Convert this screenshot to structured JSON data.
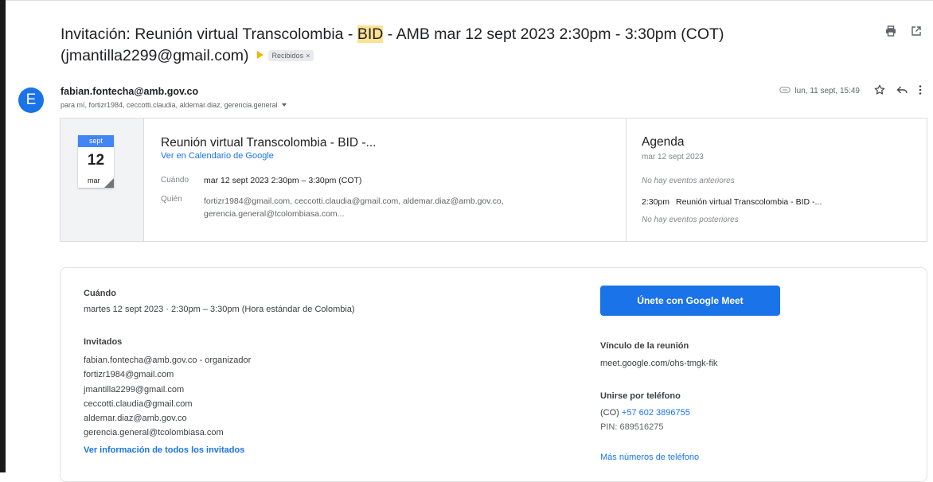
{
  "subject": {
    "before": "Invitación: Reunión virtual Transcolombia - ",
    "highlight": "BID",
    "after": " - AMB mar 12 sept 2023 2:30pm - 3:30pm (COT)",
    "line2": "(jmantilla2299@gmail.com)",
    "label": "Recibidos",
    "label_close": "×"
  },
  "top_icons": [
    "print-icon",
    "open-in-new-window-icon"
  ],
  "sender": {
    "avatar_letter": "E",
    "email": "fabian.fontecha@amb.gov.co",
    "recipients": "para mí, fortizr1984, ceccotti.claudia, aldemar.diaz, gerencia.general",
    "date": "lun, 11 sept, 15:49"
  },
  "invite": {
    "cal_month_head": "sept",
    "cal_day": "12",
    "cal_weekday": "mar",
    "title": "Reunión virtual Transcolombia - BID -...",
    "calendar_link": "Ver en Calendario de Google",
    "when_label": "Cuándo",
    "when_value": "mar 12 sept 2023 2:30pm – 3:30pm (COT)",
    "who_label": "Quién",
    "who_value": "fortizr1984@gmail.com, ceccotti.claudia@gmail.com, aldemar.diaz@amb.gov.co, gerencia.general@tcolombiasa.com..."
  },
  "agenda": {
    "title": "Agenda",
    "date": "mar 12 sept 2023",
    "no_before": "No hay eventos anteriores",
    "event_time": "2:30pm",
    "event_title": "Reunión virtual Transcolombia - BID -...",
    "no_after": "No hay eventos posteriores"
  },
  "details": {
    "when_label": "Cuándo",
    "when_value": "martes 12 sept 2023 · 2:30pm – 3:30pm (Hora estándar de Colombia)",
    "guests_label": "Invitados",
    "guests": [
      "fabian.fontecha@amb.gov.co - organizador",
      "fortizr1984@gmail.com",
      "jmantilla2299@gmail.com",
      "ceccotti.claudia@gmail.com",
      "aldemar.diaz@amb.gov.co",
      "gerencia.general@tcolombiasa.com"
    ],
    "all_guests_link": "Ver información de todos los invitados",
    "meet_button": "Únete con Google Meet",
    "meeting_link_label": "Vínculo de la reunión",
    "meeting_link": "meet.google.com/ohs-tmgk-fik",
    "phone_label": "Unirse por teléfono",
    "phone_country": "(CO)",
    "phone_number": "+57 602 3896755",
    "pin": "PIN: 689516275",
    "more_numbers": "Más números de teléfono"
  },
  "colors": {
    "accent": "#1a73e8",
    "highlight": "#fde293",
    "important_marker": "#f4b400"
  }
}
